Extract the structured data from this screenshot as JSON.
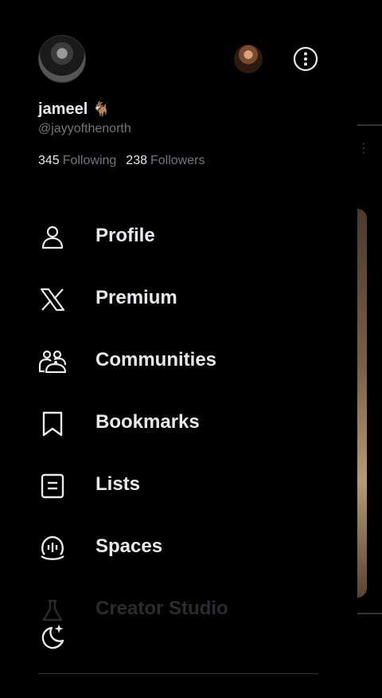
{
  "profile": {
    "display_name": "jameel",
    "name_emoji": "🐐",
    "handle": "@jayyofthenorth",
    "following_count": "345",
    "following_label": "Following",
    "followers_count": "238",
    "followers_label": "Followers"
  },
  "menu": {
    "items": [
      {
        "label": "Profile",
        "icon": "person-icon"
      },
      {
        "label": "Premium",
        "icon": "x-logo-icon"
      },
      {
        "label": "Communities",
        "icon": "communities-icon"
      },
      {
        "label": "Bookmarks",
        "icon": "bookmark-icon"
      },
      {
        "label": "Lists",
        "icon": "list-icon"
      },
      {
        "label": "Spaces",
        "icon": "spaces-icon"
      },
      {
        "label": "Creator Studio",
        "icon": "flask-icon"
      }
    ]
  },
  "colors": {
    "background": "#000000",
    "text_primary": "#e7e9ea",
    "text_secondary": "#71767b",
    "divider": "#2f3336"
  }
}
